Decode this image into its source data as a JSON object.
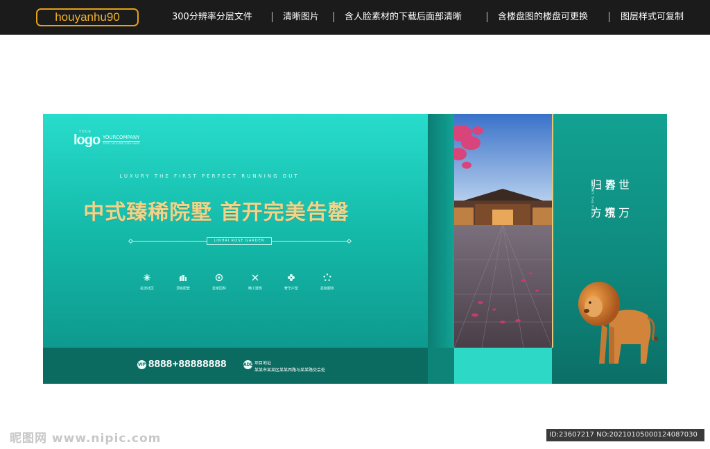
{
  "topbar": {
    "author": "houyanhu90",
    "features": [
      "300分辨率分层文件",
      "清晰图片",
      "含人脸素材的下载后面部清晰",
      "含楼盘图的楼盘可更换",
      "图层样式可复制"
    ]
  },
  "banner": {
    "logo": {
      "your": "YOUR",
      "main": "logo",
      "company": "YOURCOMPANY",
      "slogan": "YOUR SLOGAN GOES HERE"
    },
    "en_line": "LUXURY THE FIRST PERFECT RUNNING OUT",
    "title": "中式臻稀院墅 首开完美告罄",
    "garden_tag": "LINHAI ROSE GARDEN",
    "features": [
      {
        "icon": "snowflake-icon",
        "label": "名流社区"
      },
      {
        "icon": "building-icon",
        "label": "顶级配套"
      },
      {
        "icon": "ring-icon",
        "label": "皇家园林"
      },
      {
        "icon": "tools-icon",
        "label": "精工建筑"
      },
      {
        "icon": "flower-icon",
        "label": "奢华户型"
      },
      {
        "icon": "dots-icon",
        "label": "星级服务"
      }
    ],
    "phone_icon": "VIP",
    "phone": "8888+88888888",
    "address_icon": "ADD",
    "address_title": "项目地址",
    "address": "某某市某某区某某西路与某某路交会处",
    "slogan_cols": [
      "世界",
      "万境",
      "皆归",
      "东方"
    ],
    "slogan_small": "LUXURY THE FIRST",
    "colors": {
      "teal_light": "#28dccc",
      "teal_dark": "#0c6b61",
      "gold": "#f1d38a"
    }
  },
  "watermark": {
    "left": "昵图网 www.nipic.com",
    "right": "ID:23607217 NO:20210105000124087030"
  }
}
